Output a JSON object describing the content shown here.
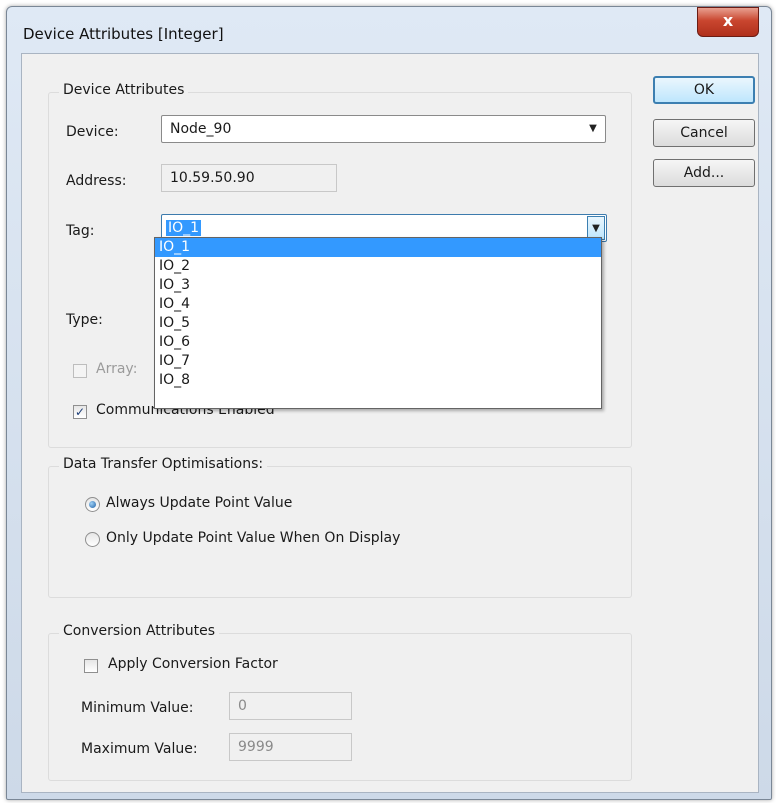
{
  "window": {
    "title": "Device Attributes  [Integer]",
    "close_glyph": "x"
  },
  "buttons": {
    "ok": "OK",
    "cancel": "Cancel",
    "add": "Add..."
  },
  "device_group": {
    "legend": "Device Attributes",
    "device_label": "Device:",
    "device_value": "Node_90",
    "address_label": "Address:",
    "address_value": "10.59.50.90",
    "tag_label": "Tag:",
    "tag_value": "IO_1",
    "type_label": "Type:",
    "array_label": "Array:",
    "array_checked": false,
    "comms_label": "Communications Enabled",
    "comms_checked": true
  },
  "tag_options": [
    "IO_1",
    "IO_2",
    "IO_3",
    "IO_4",
    "IO_5",
    "IO_6",
    "IO_7",
    "IO_8"
  ],
  "tag_selected_index": 0,
  "transfer_group": {
    "legend": "Data Transfer Optimisations:",
    "options": [
      "Always Update Point Value",
      "Only Update Point Value When On Display"
    ],
    "selected_index": 0
  },
  "conversion_group": {
    "legend": "Conversion Attributes",
    "apply_label": "Apply Conversion Factor",
    "apply_checked": false,
    "min_label": "Minimum Value:",
    "min_value": "0",
    "max_label": "Maximum Value:",
    "max_value": "9999"
  },
  "icons": {
    "dropdown": "chevron-down-icon",
    "check": "checkmark-icon",
    "close": "close-icon"
  }
}
